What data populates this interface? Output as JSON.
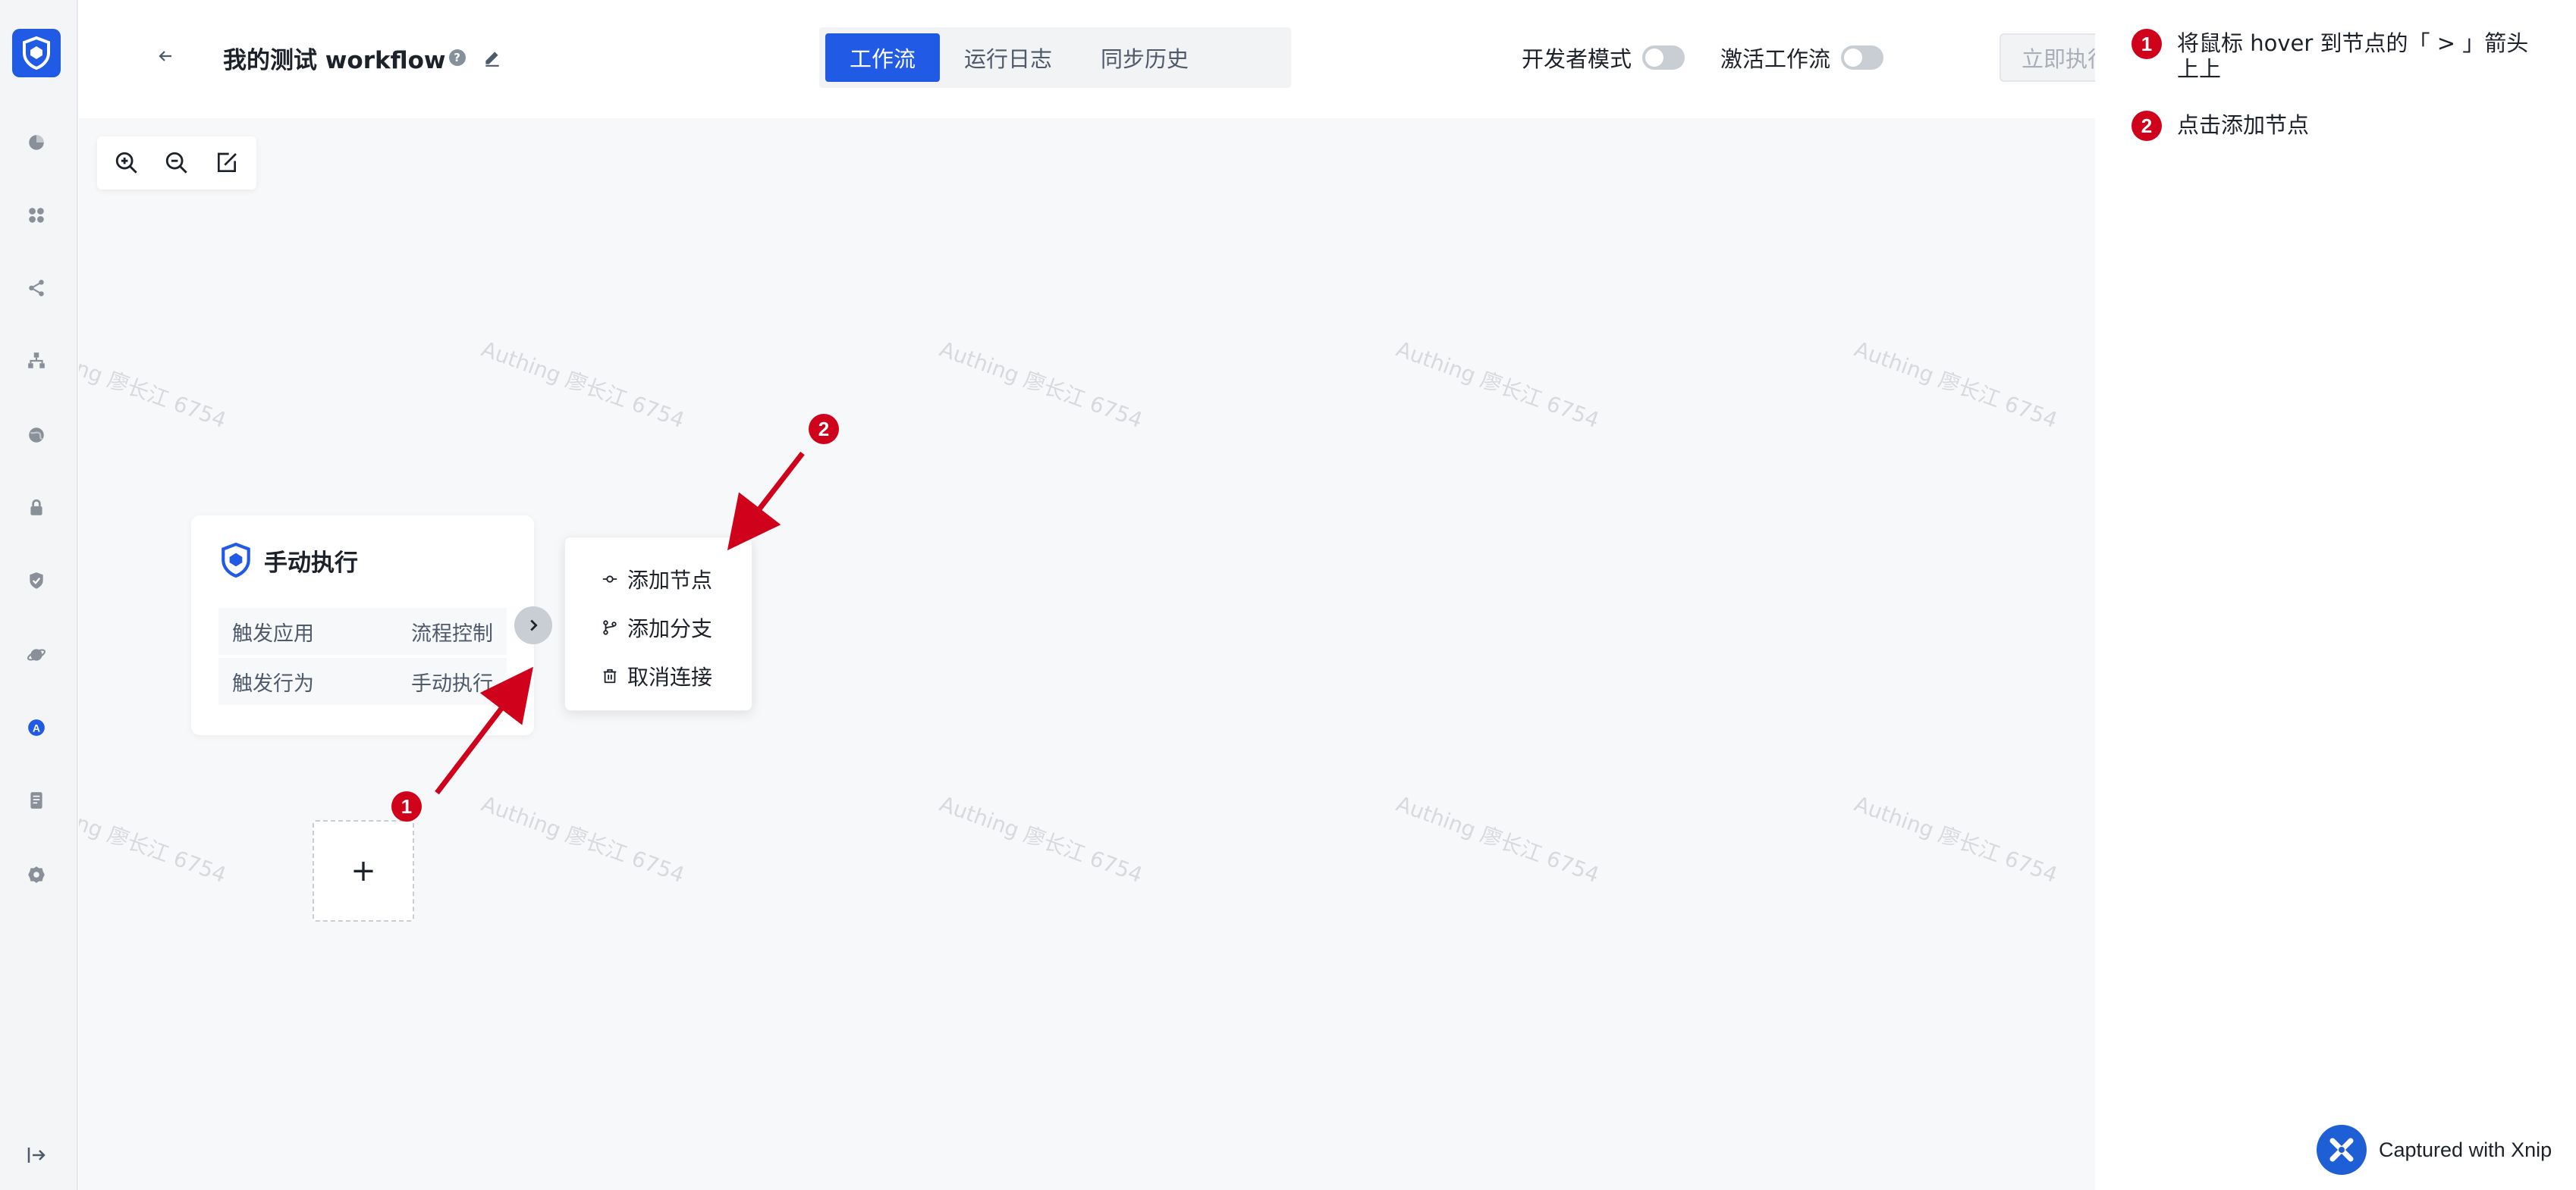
{
  "header": {
    "title": "我的测试 workflow",
    "help_mark": "?",
    "tabs": [
      {
        "label": "工作流",
        "active": true
      },
      {
        "label": "运行日志",
        "active": false
      },
      {
        "label": "同步历史",
        "active": false
      }
    ],
    "dev_mode_label": "开发者模式",
    "dev_mode_on": false,
    "activate_label": "激活工作流",
    "activate_on": false,
    "run_button_label": "立即执行",
    "run_button_disabled": true
  },
  "sidebar": {
    "icons": [
      "dashboard-icon",
      "apps-icon",
      "share-icon",
      "org-icon",
      "globe-icon",
      "lock-icon",
      "shield-check-icon",
      "planet-icon",
      "brand-a-icon",
      "document-icon",
      "settings-icon"
    ],
    "collapse_icon": "collapse-icon"
  },
  "canvas": {
    "watermark_text": "Authing 廖长江 6754",
    "node": {
      "title": "手动执行",
      "rows": [
        {
          "label": "触发应用",
          "value": "流程控制"
        },
        {
          "label": "触发行为",
          "value": "手动执行"
        }
      ]
    },
    "add_placeholder": "+",
    "menu": {
      "items": [
        {
          "label": "添加节点",
          "icon": "node-icon"
        },
        {
          "label": "添加分支",
          "icon": "branch-icon"
        },
        {
          "label": "取消连接",
          "icon": "trash-icon"
        }
      ]
    }
  },
  "annotations": {
    "badge1": "1",
    "badge2": "2",
    "color": "#d0021b"
  },
  "notes": [
    {
      "num": "1",
      "text": "将鼠标 hover 到节点的「 > 」箭头上上"
    },
    {
      "num": "2",
      "text": "点击添加节点"
    }
  ],
  "footer": {
    "capture_text": "Captured with Xnip"
  },
  "colors": {
    "primary": "#215ae5",
    "canvas_bg": "#f7f8fa"
  }
}
